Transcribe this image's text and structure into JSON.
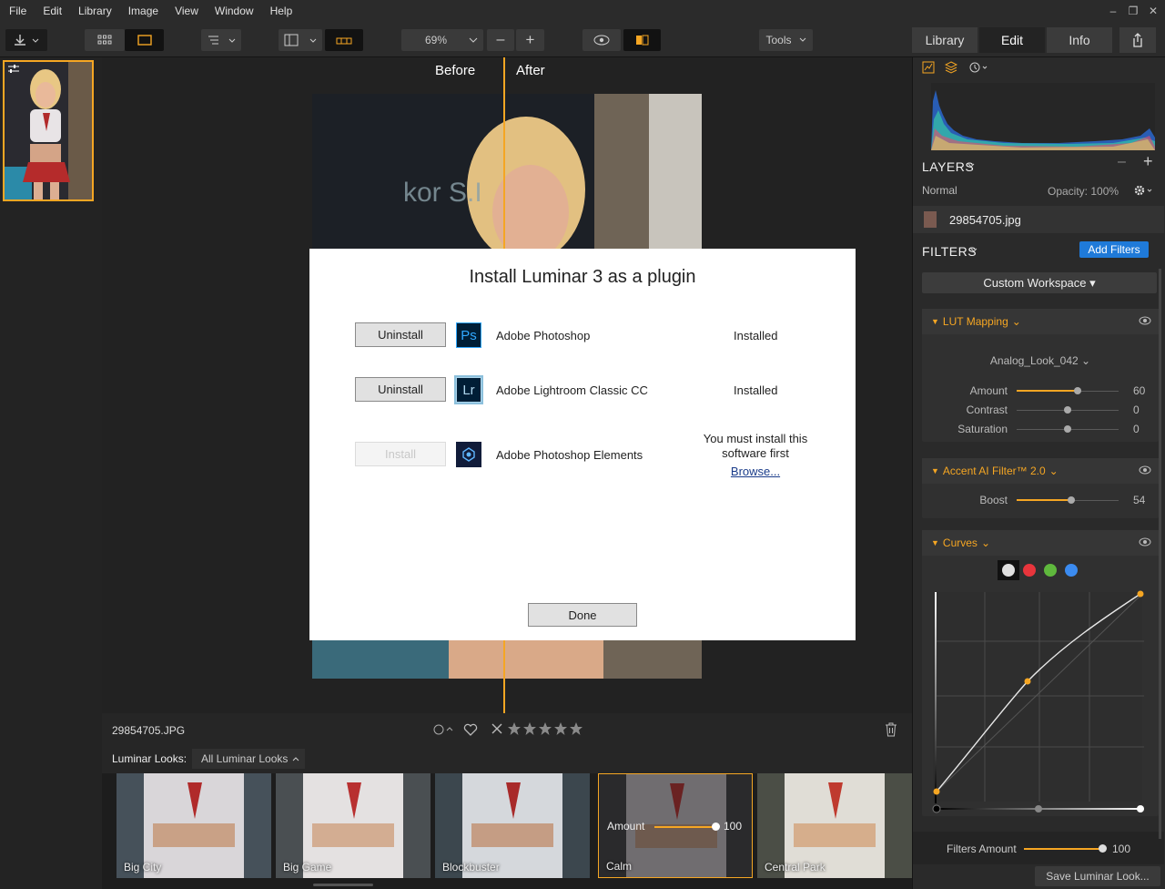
{
  "menu": [
    "File",
    "Edit",
    "Library",
    "Image",
    "View",
    "Window",
    "Help"
  ],
  "window_controls": {
    "minimize": "–",
    "maximize": "❐",
    "close": "✕"
  },
  "toolbar": {
    "zoom": "69%",
    "zoom_out": "–",
    "zoom_in": "+",
    "tools_label": "Tools",
    "tabs": [
      "Library",
      "Edit",
      "Info"
    ],
    "active_tab": "Edit"
  },
  "canvas": {
    "before_label": "Before",
    "after_label": "After",
    "photo_text": "kor S.I"
  },
  "info_row": {
    "filename": "29854705.JPG",
    "stars": 5
  },
  "looks_bar": {
    "label": "Luminar Looks:",
    "dropdown": "All Luminar Looks"
  },
  "looks": [
    {
      "name": "Big City"
    },
    {
      "name": "Big Game"
    },
    {
      "name": "Blockbuster"
    },
    {
      "name": "Calm",
      "selected": true,
      "amount_label": "Amount",
      "amount": 100
    },
    {
      "name": "Central Park"
    }
  ],
  "right_panel": {
    "layers_title": "LAYERS",
    "blend_mode": "Normal",
    "opacity": "Opacity: 100%",
    "layer_name": "29854705.jpg",
    "filters_title": "FILTERS",
    "add_filters": "Add Filters",
    "workspace": "Custom Workspace",
    "filters": [
      {
        "name": "LUT Mapping",
        "preset": "Analog_Look_042",
        "sliders": [
          {
            "label": "Amount",
            "value": 60,
            "display": "60",
            "bipolar": false
          },
          {
            "label": "Contrast",
            "value": 0,
            "display": "0",
            "bipolar": true
          },
          {
            "label": "Saturation",
            "value": 0,
            "display": "0",
            "bipolar": true
          }
        ]
      },
      {
        "name": "Accent AI Filter™ 2.0",
        "sliders": [
          {
            "label": "Boost",
            "value": 54,
            "display": "54",
            "bipolar": false
          }
        ]
      },
      {
        "name": "Curves",
        "channels": [
          "#e0e0e0",
          "#e8353c",
          "#5fb83d",
          "#3b8bf0"
        ]
      }
    ],
    "filters_amount_label": "Filters Amount",
    "filters_amount": 100,
    "save_look": "Save Luminar Look..."
  },
  "modal": {
    "title": "Install Luminar 3 as a plugin",
    "rows": [
      {
        "button": "Uninstall",
        "icon": "Ps",
        "app": "Adobe Photoshop",
        "status": "Installed",
        "enabled": true
      },
      {
        "button": "Uninstall",
        "icon": "Lr",
        "app": "Adobe Lightroom Classic CC",
        "status": "Installed",
        "enabled": true
      },
      {
        "button": "Install",
        "icon": "",
        "app": "Adobe Photoshop Elements",
        "status_line1": "You must install this",
        "status_line2": "software first",
        "link": "Browse...",
        "enabled": false
      }
    ],
    "done": "Done"
  },
  "colors": {
    "accent": "#f5a623",
    "panel": "#2a2a2a",
    "add_filters": "#1f7ad9"
  }
}
